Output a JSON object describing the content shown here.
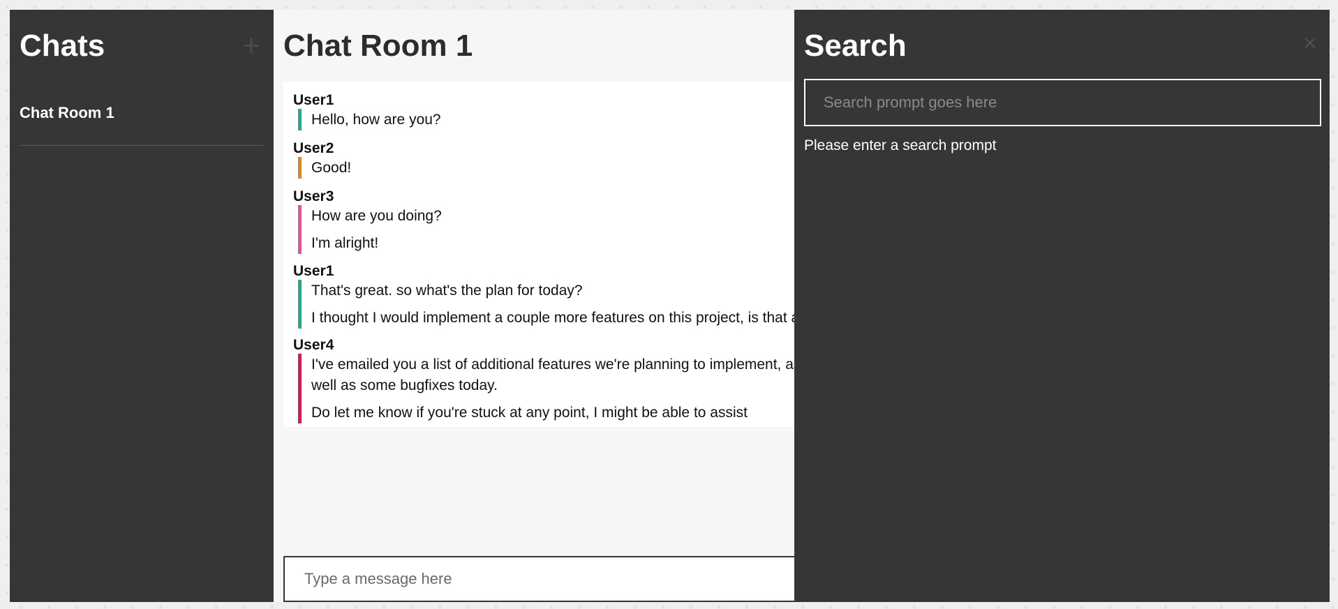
{
  "sidebar": {
    "title": "Chats",
    "add_icon": "plus-icon",
    "items": [
      {
        "label": "Chat Room 1"
      }
    ]
  },
  "room": {
    "title": "Chat Room 1",
    "groups": [
      {
        "user": "User1",
        "color": "#1aae8a",
        "messages": [
          "Hello, how are you?"
        ]
      },
      {
        "user": "User2",
        "color": "#e0860f",
        "messages": [
          "Good!"
        ]
      },
      {
        "user": "User3",
        "color": "#e84fa6",
        "messages": [
          "How are you doing?",
          "I'm alright!"
        ]
      },
      {
        "user": "User1",
        "color": "#1aae8a",
        "messages": [
          "That's great. so what's the plan for today?",
          "I thought I would implement a couple more features on this project, is that alright?"
        ]
      },
      {
        "user": "User4",
        "color": "#e8114f",
        "messages": [
          "I've emailed you a list of additional features we're planning to implement, as well as some bugfixes today.",
          "Do let me know if you're stuck at any point, I might be able to assist"
        ]
      }
    ],
    "composer_placeholder": "Type a message here"
  },
  "search": {
    "title": "Search",
    "close_icon": "close-icon",
    "placeholder": "Search prompt goes here",
    "status": "Please enter a search prompt"
  }
}
